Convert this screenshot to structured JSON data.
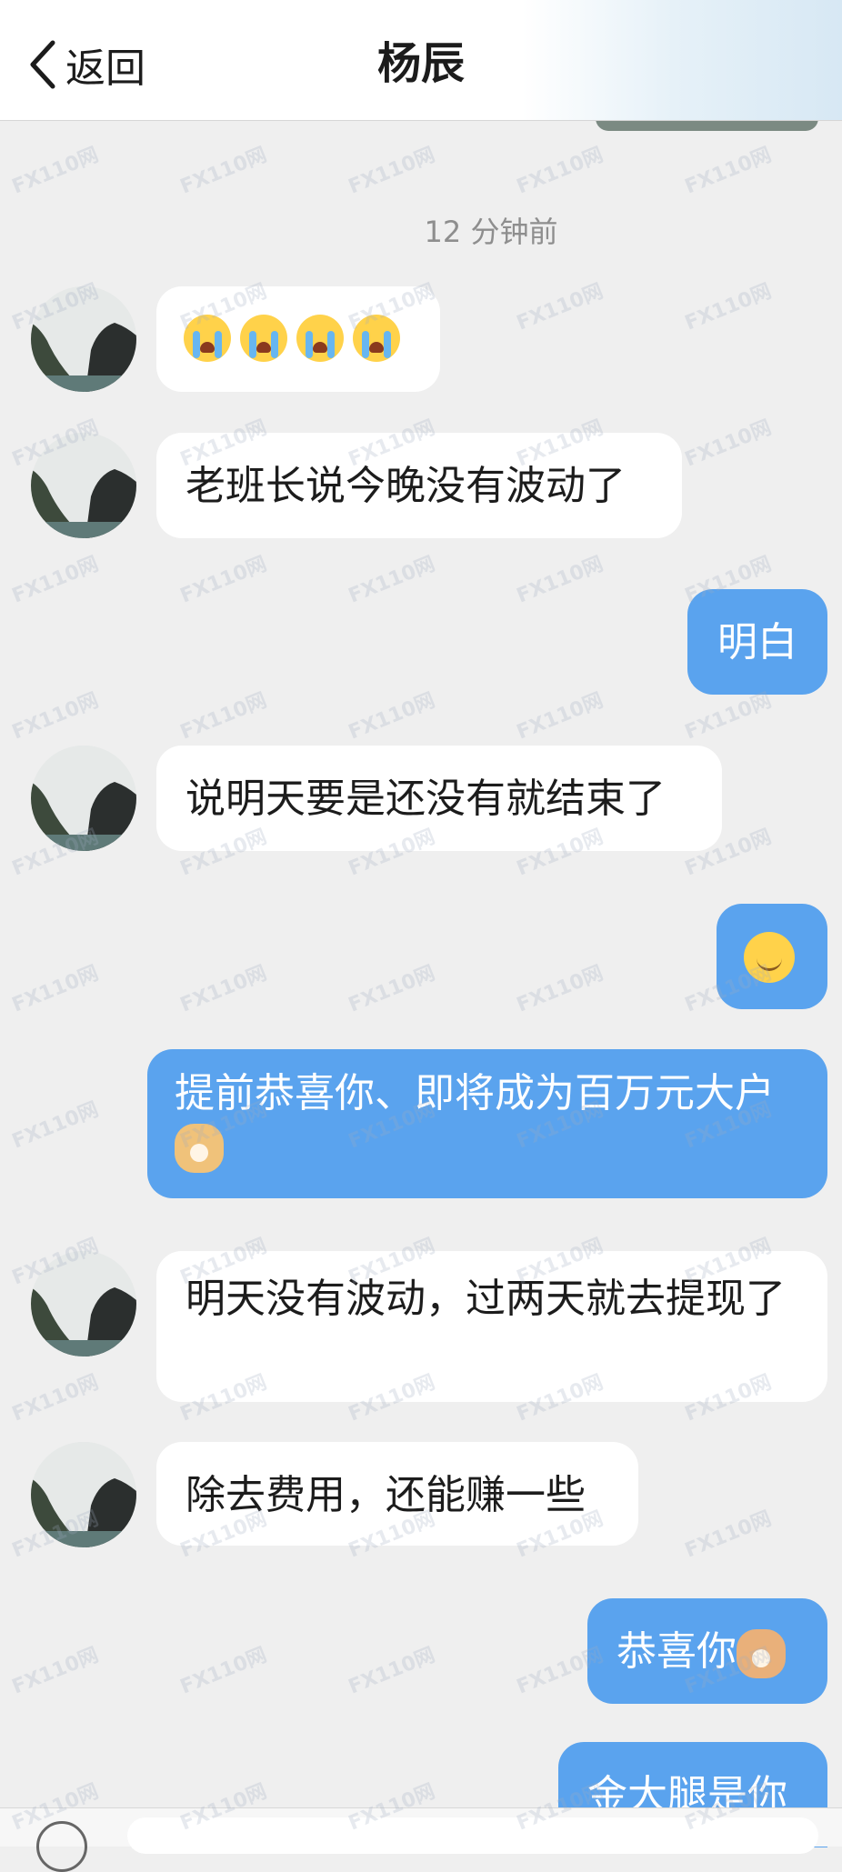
{
  "header": {
    "back_label": "返回",
    "title": "杨辰"
  },
  "timestamp": "12 分钟前",
  "messages": [
    {
      "side": "in",
      "text": "",
      "emoji": [
        "cry",
        "cry",
        "cry",
        "cry"
      ]
    },
    {
      "side": "in",
      "text": "老班长说今晚没有波动了"
    },
    {
      "side": "out",
      "text": "明白"
    },
    {
      "side": "in",
      "text": "说明天要是还没有就结束了"
    },
    {
      "side": "out",
      "text": "",
      "emoji": [
        "smile"
      ]
    },
    {
      "side": "out",
      "text": "提前恭喜你、即将成为百万元大户",
      "emoji": [
        "dog"
      ]
    },
    {
      "side": "in",
      "text": "明天没有波动，过两天就去提现了"
    },
    {
      "side": "in",
      "text": "除去费用，还能赚一些"
    },
    {
      "side": "out",
      "text": "恭喜你",
      "emoji": [
        "cat"
      ]
    },
    {
      "side": "out",
      "text": "金大腿是你"
    }
  ],
  "watermark_text": "FX110网",
  "colors": {
    "outgoing_bubble": "#5aa3ee",
    "incoming_bubble": "#ffffff",
    "background": "#efefef"
  }
}
